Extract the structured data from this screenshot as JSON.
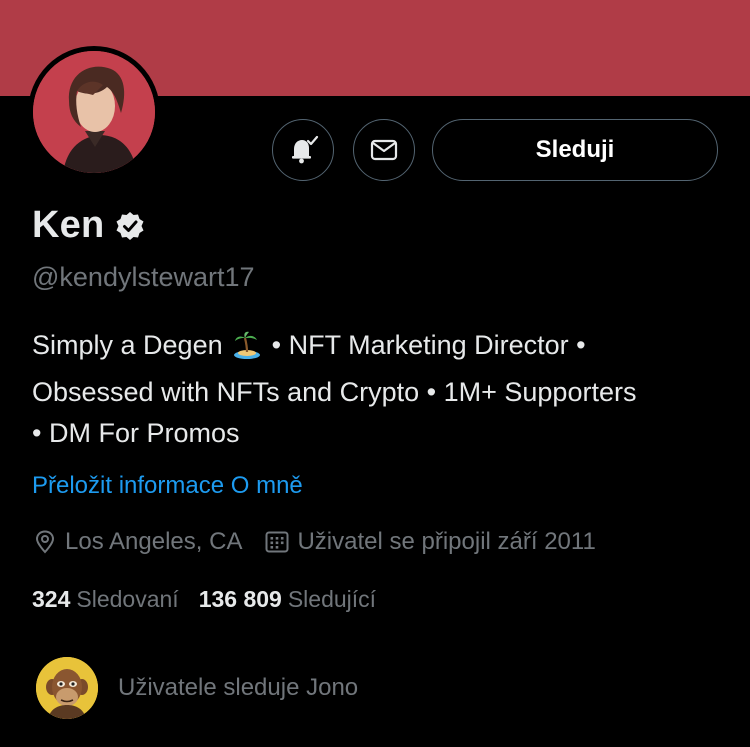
{
  "profile": {
    "name": "Ken",
    "handle": "@kendylstewart17",
    "bio_line1_a": "Simply a Degen",
    "bio_line1_b": "• NFT Marketing Director •",
    "bio_line2": "Obsessed with NFTs and Crypto • 1M+ Supporters",
    "bio_line3": "• DM For Promos",
    "bio_emoji": "desert-island-emoji",
    "translate_link": "Přeložit informace O mně",
    "location": "Los Angeles, CA",
    "joined": "Uživatel se připojil září 2011"
  },
  "actions": {
    "follow_label": "Sleduji",
    "bell_icon": "bell-check-icon",
    "mail_icon": "envelope-icon"
  },
  "stats": {
    "following_count": "324",
    "following_label": "Sledovaní",
    "followers_count": "136 809",
    "followers_label": "Sledující"
  },
  "followed_by": {
    "text": "Uživatele sleduje Jono"
  },
  "colors": {
    "banner": "#b03c47",
    "background": "#000000",
    "link": "#1d9bf0",
    "secondary_text": "#71767b",
    "border": "#536471"
  }
}
